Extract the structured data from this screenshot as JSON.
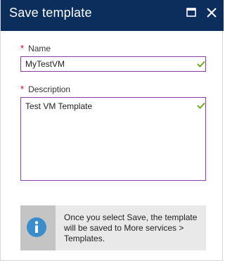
{
  "header": {
    "title": "Save template",
    "maximize_icon": "maximize-icon",
    "close_icon": "close-icon"
  },
  "form": {
    "name": {
      "label": "Name",
      "required_mark": "*",
      "value": "MyTestVM",
      "valid": true
    },
    "description": {
      "label": "Description",
      "required_mark": "*",
      "value": "Test VM Template",
      "valid": true
    }
  },
  "info": {
    "icon": "info-icon",
    "message": "Once you select Save, the template will be saved to More services > Templates."
  },
  "colors": {
    "header_bg": "#0b2e5c",
    "input_border": "#8a3fa6",
    "valid_check": "#5ea614",
    "required_star": "#d0021b",
    "info_icon": "#3a8ccb"
  }
}
